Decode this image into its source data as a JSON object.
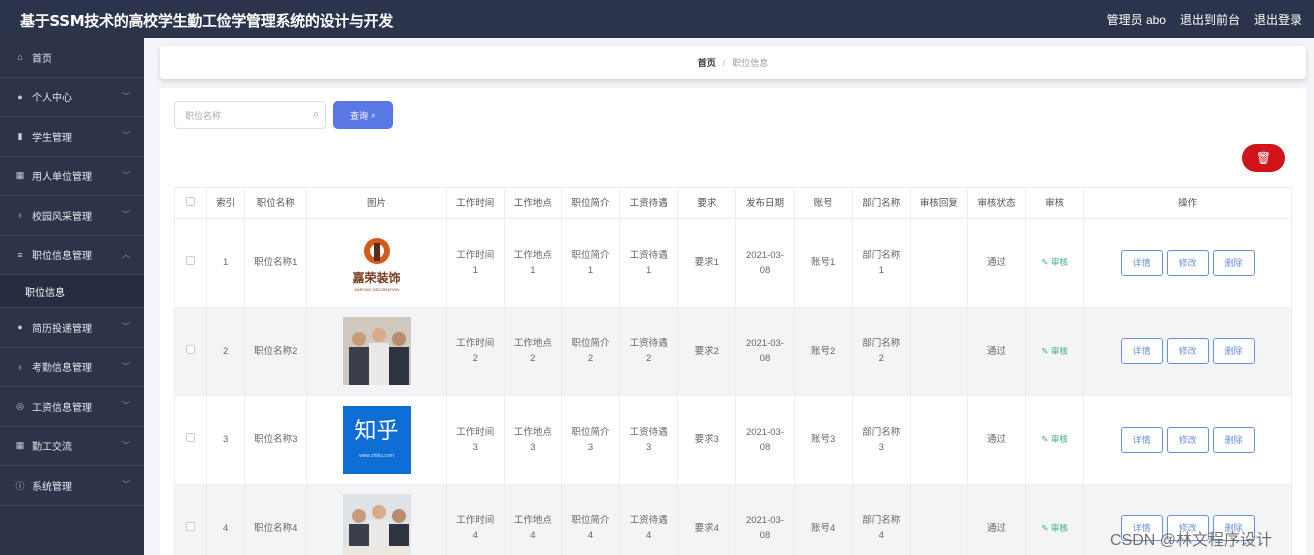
{
  "header": {
    "title": "基于SSM技术的高校学生勤工俭学管理系统的设计与开发",
    "admin": "管理员 abo",
    "back_front": "退出到前台",
    "logout": "退出登录"
  },
  "sidebar": {
    "items": [
      {
        "label": "首页",
        "icon": "home-icon"
      },
      {
        "label": "个人中心",
        "icon": "user-icon"
      },
      {
        "label": "学生管理",
        "icon": "chart-icon"
      },
      {
        "label": "用人单位管理",
        "icon": "grid-icon"
      },
      {
        "label": "校园风采管理",
        "icon": "mic-icon"
      },
      {
        "label": "职位信息管理",
        "icon": "list-icon"
      },
      {
        "label": "职位信息",
        "icon": ""
      },
      {
        "label": "简历投递管理",
        "icon": "user-icon"
      },
      {
        "label": "考勤信息管理",
        "icon": "mic-icon"
      },
      {
        "label": "工资信息管理",
        "icon": "globe-icon"
      },
      {
        "label": "勤工交流",
        "icon": "grid-icon"
      },
      {
        "label": "系统管理",
        "icon": "info-icon"
      }
    ]
  },
  "breadcrumb": {
    "home": "首页",
    "sep": "/",
    "current": "职位信息"
  },
  "search": {
    "placeholder": "职位名称",
    "button": "查询"
  },
  "table": {
    "headers": [
      "索引",
      "职位名称",
      "图片",
      "工作时间",
      "工作地点",
      "职位简介",
      "工资待遇",
      "要求",
      "发布日期",
      "账号",
      "部门名称",
      "审核回复",
      "审核状态",
      "审核",
      "操作"
    ],
    "rows": [
      {
        "index": "1",
        "name": "职位名称1",
        "time": "工作时间\n1",
        "place": "工作地点\n1",
        "intro": "职位简介\n1",
        "salary": "工资待遇\n1",
        "req": "要求1",
        "date": "2021-03-\n08",
        "account": "账号1",
        "dept": "部门名称\n1",
        "reply": "",
        "status": "通过",
        "audit": "审核"
      },
      {
        "index": "2",
        "name": "职位名称2",
        "time": "工作时间\n2",
        "place": "工作地点\n2",
        "intro": "职位简介\n2",
        "salary": "工资待遇\n2",
        "req": "要求2",
        "date": "2021-03-\n08",
        "account": "账号2",
        "dept": "部门名称\n2",
        "reply": "",
        "status": "通过",
        "audit": "审核"
      },
      {
        "index": "3",
        "name": "职位名称3",
        "time": "工作时间\n3",
        "place": "工作地点\n3",
        "intro": "职位简介\n3",
        "salary": "工资待遇\n3",
        "req": "要求3",
        "date": "2021-03-\n08",
        "account": "账号3",
        "dept": "部门名称\n3",
        "reply": "",
        "status": "通过",
        "audit": "审核"
      },
      {
        "index": "4",
        "name": "职位名称4",
        "time": "工作时间\n4",
        "place": "工作地点\n4",
        "intro": "职位简介\n4",
        "salary": "工资待遇\n4",
        "req": "要求4",
        "date": "2021-03-\n08",
        "account": "账号4",
        "dept": "部门名称\n4",
        "reply": "",
        "status": "通过",
        "audit": "审核"
      }
    ],
    "actions": {
      "detail": "详情",
      "edit": "修改",
      "delete": "删除"
    },
    "images": [
      {
        "text": "嘉荣装饰",
        "sub": "JIARONG DECORATION"
      },
      {
        "text": ""
      },
      {
        "text": "知乎",
        "sub": "www.zhihu.com"
      },
      {
        "text": ""
      }
    ]
  },
  "watermark": "CSDN @林文程序设计"
}
